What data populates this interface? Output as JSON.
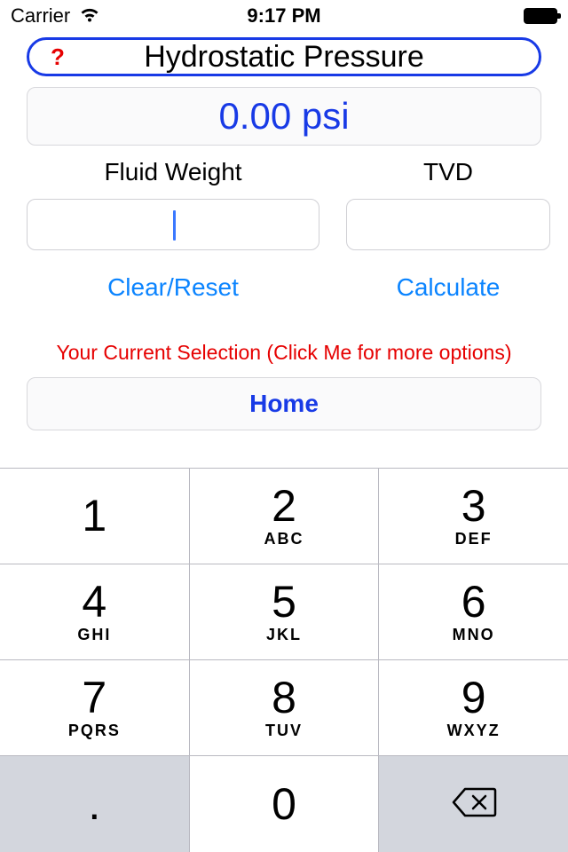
{
  "status": {
    "carrier": "Carrier",
    "time": "9:17 PM"
  },
  "title": {
    "help": "?",
    "text": "Hydrostatic Pressure"
  },
  "result": {
    "text": "0.00 psi"
  },
  "fields": {
    "fluid_weight": {
      "label": "Fluid Weight"
    },
    "tvd": {
      "label": "TVD"
    }
  },
  "actions": {
    "clear": "Clear/Reset",
    "calculate": "Calculate"
  },
  "hint": "Your Current Selection (Click Me for more options)",
  "home": {
    "label": "Home"
  },
  "keypad": {
    "keys": [
      {
        "d": "1",
        "l": ""
      },
      {
        "d": "2",
        "l": "ABC"
      },
      {
        "d": "3",
        "l": "DEF"
      },
      {
        "d": "4",
        "l": "GHI"
      },
      {
        "d": "5",
        "l": "JKL"
      },
      {
        "d": "6",
        "l": "MNO"
      },
      {
        "d": "7",
        "l": "PQRS"
      },
      {
        "d": "8",
        "l": "TUV"
      },
      {
        "d": "9",
        "l": "WXYZ"
      }
    ],
    "dot": ".",
    "zero": "0"
  }
}
